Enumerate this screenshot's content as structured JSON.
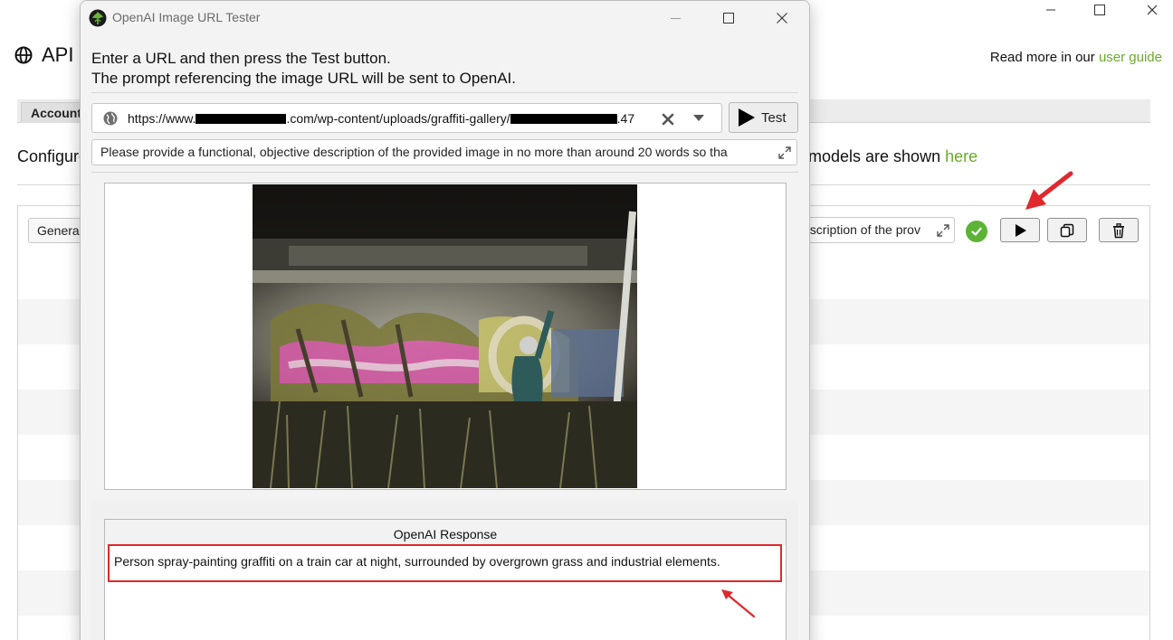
{
  "background": {
    "window_controls": [
      "minimize",
      "maximize",
      "close"
    ],
    "page_title": "API",
    "read_more_prefix": "Read more in our ",
    "read_more_link": "user guide",
    "tab_label": "Account",
    "config_text": "Configure",
    "models_text": "models are shown ",
    "models_link": "here",
    "general_field": "General",
    "description_field": "escription of the prov",
    "status_icon": "check-circle-icon",
    "row_buttons": [
      "play-icon",
      "copy-icon",
      "trash-icon"
    ]
  },
  "dialog": {
    "title": "OpenAI Image URL Tester",
    "instruction_line1": "Enter a URL and then press the Test button.",
    "instruction_line2": "The prompt referencing the image URL will be sent to OpenAI.",
    "url": {
      "part1": "https://www.",
      "part2": ".com/wp-content/uploads/graffiti-gallery/",
      "part3": ".47"
    },
    "test_button": "Test",
    "prompt": "Please provide a functional, objective description of the provided image in no more than around 20 words so tha",
    "response_header": "OpenAI Response",
    "response_text": "Person spray-painting graffiti on a train car at night, surrounded by overgrown grass and industrial elements."
  },
  "colors": {
    "link_green": "#6aaa2a",
    "annotation_red": "#e0282e",
    "check_green": "#5cb335"
  }
}
